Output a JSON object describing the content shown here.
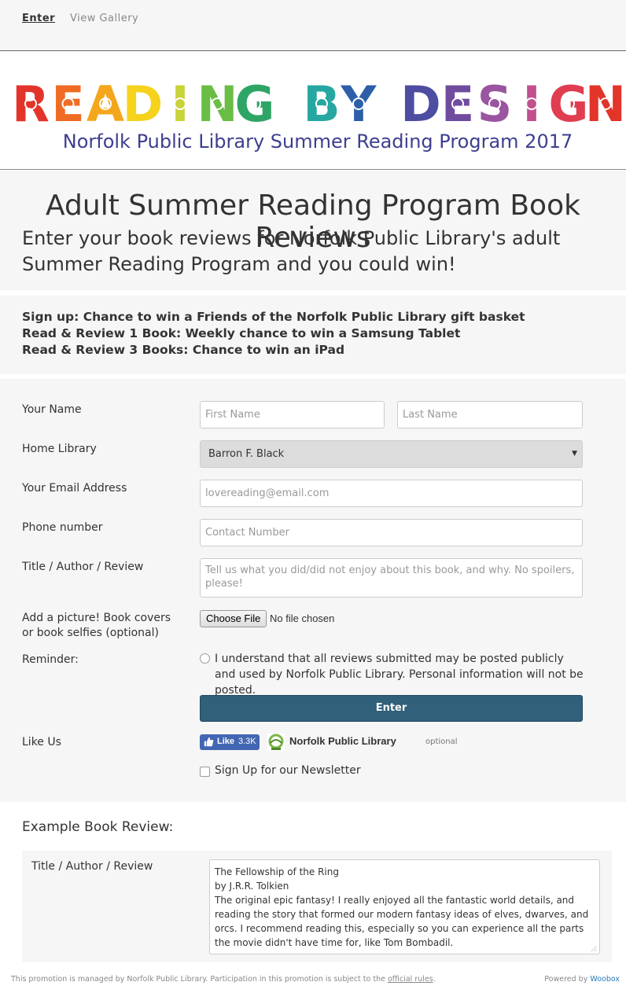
{
  "nav": {
    "enter": "Enter",
    "gallery": "View Gallery"
  },
  "banner": {
    "word1": "READING",
    "word2": "BY",
    "word3": "DESIGN",
    "subtitle": "Norfolk Public Library Summer Reading Program 2017",
    "colors": [
      "#e3342a",
      "#f06b23",
      "#f4a71d",
      "#f5d21c",
      "#c9d33a",
      "#6abd45",
      "#2ea567",
      "#27a7a2",
      "#2d5fa9",
      "#4d4ea1",
      "#6f4c9e",
      "#9a54a0",
      "#c2508d",
      "#e03d50"
    ]
  },
  "heading": {
    "title": "Adult Summer Reading Program Book Reviews",
    "subtitle": "Enter your book reviews for Norfolk Public Library's adult Summer Reading Program and you could win!"
  },
  "prizes": [
    "Sign up: Chance to win a Friends of the Norfolk Public Library gift basket",
    "Read & Review 1 Book: Weekly chance to win a Samsung Tablet",
    "Read & Review 3 Books: Chance to win an iPad"
  ],
  "form": {
    "name_label": "Your Name",
    "first_placeholder": "First Name",
    "last_placeholder": "Last Name",
    "library_label": "Home Library",
    "library_value": "Barron F. Black",
    "email_label": "Your Email Address",
    "email_placeholder": "lovereading@email.com",
    "phone_label": "Phone number",
    "phone_placeholder": "Contact Number",
    "review_label": "Title / Author / Review",
    "review_placeholder": "Tell us what you did/did not enjoy about this book, and why. No spoilers, please!",
    "picture_label": "Add a picture! Book covers or book selfies (optional)",
    "file_button": "Choose File",
    "file_status": "No file chosen",
    "reminder_label": "Reminder:",
    "reminder_text": "I understand that all reviews submitted may be posted publicly and used by Norfolk Public Library. Personal information will not be posted.",
    "submit": "Enter",
    "like_label": "Like Us",
    "fb_like": "Like",
    "fb_count": "3.3K",
    "fb_page": "Norfolk Public Library",
    "optional": "optional",
    "newsletter": "Sign Up for our Newsletter"
  },
  "example": {
    "title": "Example Book Review:",
    "label": "Title / Author / Review",
    "lines": [
      "The Fellowship of the Ring",
      "by J.R.R. Tolkien",
      "The original epic fantasy! I really enjoyed all the fantastic world details, and reading the story that formed our modern fantasy ideas of elves, dwarves, and orcs. I recommend reading this, especially so you can experience all the parts the movie didn't have time for, like Tom Bombadil."
    ]
  },
  "footer": {
    "text": "This promotion is managed by Norfolk Public Library. Participation in this promotion is subject to the",
    "rules_link": "official rules",
    "period": ".",
    "powered": "Powered by",
    "woobox": "Woobox"
  }
}
